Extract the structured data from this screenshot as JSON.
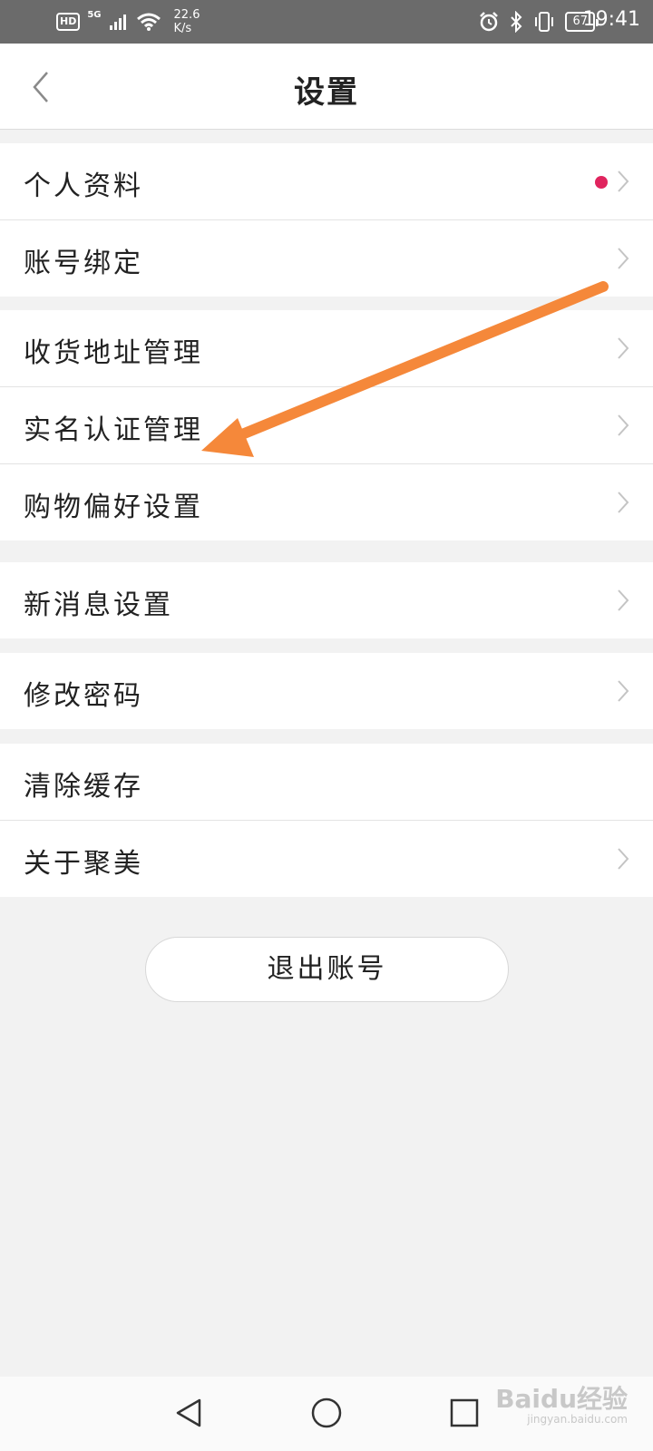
{
  "status_bar": {
    "hd": "HD",
    "network": "5G",
    "speed_value": "22.6",
    "speed_unit": "K/s",
    "battery": "67",
    "time": "19:41"
  },
  "header": {
    "title": "设置"
  },
  "groups": [
    {
      "items": [
        {
          "label": "个人资料",
          "has_dot": true
        },
        {
          "label": "账号绑定"
        }
      ]
    },
    {
      "items": [
        {
          "label": "收货地址管理"
        },
        {
          "label": "实名认证管理"
        },
        {
          "label": "购物偏好设置"
        }
      ]
    },
    {
      "items": [
        {
          "label": "新消息设置"
        }
      ]
    },
    {
      "items": [
        {
          "label": "修改密码"
        }
      ]
    },
    {
      "items": [
        {
          "label": "清除缓存",
          "no_chevron": true
        },
        {
          "label": "关于聚美"
        }
      ]
    }
  ],
  "logout_label": "退出账号",
  "watermark": {
    "main": "Baidu经验",
    "sub": "jingyan.baidu.com"
  },
  "colors": {
    "dot": "#e0245e",
    "arrow": "#f5883a",
    "status_bar": "#6b6b6b"
  },
  "icons": [
    "back-chevron-icon",
    "chevron-right-icon",
    "alarm-icon",
    "bluetooth-icon",
    "vibrate-icon",
    "wifi-icon",
    "signal-icon"
  ]
}
